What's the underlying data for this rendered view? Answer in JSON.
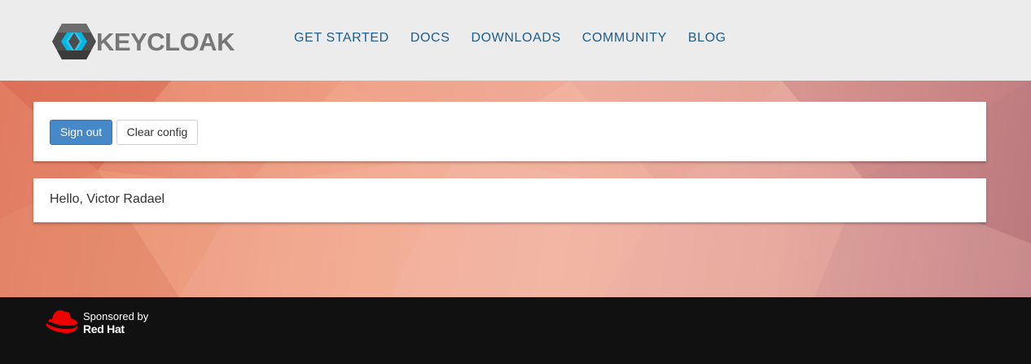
{
  "header": {
    "logo_text": "KEYCLOAK",
    "nav": [
      "GET STARTED",
      "DOCS",
      "DOWNLOADS",
      "COMMUNITY",
      "BLOG"
    ]
  },
  "actions": {
    "sign_out_label": "Sign out",
    "clear_config_label": "Clear config"
  },
  "greeting": "Hello, Victor Radael",
  "footer": {
    "sponsored_label": "Sponsored by",
    "brand": "Red Hat",
    "icon": "redhat-hat-icon"
  },
  "colors": {
    "header_bg": "#ececec",
    "nav_link": "#1e5d8c",
    "primary_button": "#4789c8",
    "footer_bg": "#111111",
    "redhat_red": "#ee0000"
  }
}
